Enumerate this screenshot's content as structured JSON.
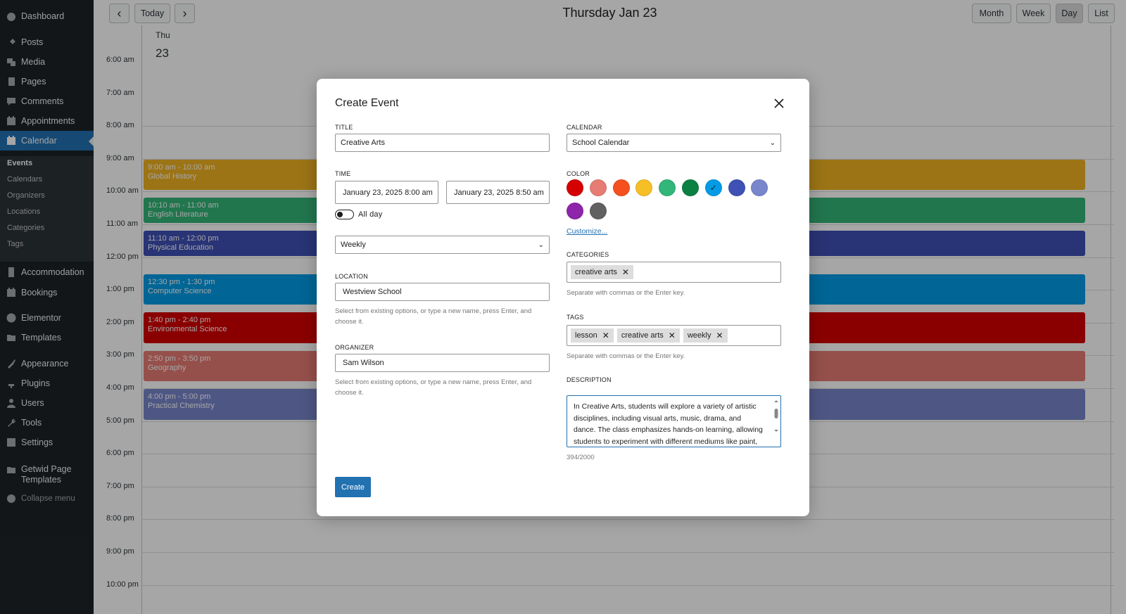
{
  "sidebar": {
    "items": [
      {
        "label": "Dashboard",
        "icon": "dashboard-icon"
      },
      {
        "label": "Posts",
        "icon": "pin-icon"
      },
      {
        "label": "Media",
        "icon": "media-icon"
      },
      {
        "label": "Pages",
        "icon": "pages-icon"
      },
      {
        "label": "Comments",
        "icon": "comment-icon"
      },
      {
        "label": "Appointments",
        "icon": "calendar-icon"
      },
      {
        "label": "Calendar",
        "icon": "calendar-icon"
      },
      {
        "label": "Accommodation",
        "icon": "building-icon"
      },
      {
        "label": "Bookings",
        "icon": "calendar-icon"
      },
      {
        "label": "Elementor",
        "icon": "elementor-icon"
      },
      {
        "label": "Templates",
        "icon": "folder-icon"
      },
      {
        "label": "Appearance",
        "icon": "brush-icon"
      },
      {
        "label": "Plugins",
        "icon": "plugin-icon"
      },
      {
        "label": "Users",
        "icon": "user-icon"
      },
      {
        "label": "Tools",
        "icon": "wrench-icon"
      },
      {
        "label": "Settings",
        "icon": "settings-icon"
      },
      {
        "label": "Getwid Page Templates",
        "icon": "folder-icon"
      },
      {
        "label": "Collapse menu",
        "icon": "collapse-icon"
      }
    ],
    "submenu": [
      "Events",
      "Calendars",
      "Organizers",
      "Locations",
      "Categories",
      "Tags"
    ]
  },
  "toolbar": {
    "prev_icon": "‹",
    "today_label": "Today",
    "next_icon": "›",
    "title": "Thursday Jan 23",
    "views": [
      "Month",
      "Week",
      "Day",
      "List"
    ],
    "active_view": "Day"
  },
  "day_header": {
    "name": "Thu",
    "number": "23"
  },
  "time_labels": [
    "6:00 am",
    "7:00 am",
    "8:00 am",
    "9:00 am",
    "10:00 am",
    "11:00 am",
    "12:00 pm",
    "1:00 pm",
    "2:00 pm",
    "3:00 pm",
    "4:00 pm",
    "5:00 pm",
    "6:00 pm",
    "7:00 pm",
    "8:00 pm",
    "9:00 pm",
    "10:00 pm"
  ],
  "events": [
    {
      "time": "9:00 am - 10:00 am",
      "title": "Global History",
      "color": "#f0b323",
      "start": 9.0,
      "end": 10.0
    },
    {
      "time": "10:10 am - 11:00 am",
      "title": "English Literature",
      "color": "#33b679",
      "start": 10.1667,
      "end": 11.0
    },
    {
      "time": "11:10 am - 12:00 pm",
      "title": "Physical Education",
      "color": "#3f51b5",
      "start": 11.1667,
      "end": 12.0
    },
    {
      "time": "12:30 pm - 1:30 pm",
      "title": "Computer Science",
      "color": "#039be5",
      "start": 12.5,
      "end": 13.5
    },
    {
      "time": "1:40 pm - 2:40 pm",
      "title": "Environmental Science",
      "color": "#d50000",
      "start": 13.6667,
      "end": 14.6667
    },
    {
      "time": "2:50 pm - 3:50 pm",
      "title": "Geography",
      "color": "#e67c73",
      "start": 14.8333,
      "end": 15.8333
    },
    {
      "time": "4:00 pm - 5:00 pm",
      "title": "Practical Chemistry",
      "color": "#7986cb",
      "start": 16.0,
      "end": 17.0
    }
  ],
  "modal": {
    "title": "Create Event",
    "close_icon": "✕",
    "title_label": "Title",
    "title_value": "Creative Arts",
    "time_label": "Time",
    "start_value": "January 23, 2025 8:00 am",
    "end_value": "January 23, 2025 8:50 am",
    "all_day_label": "All day",
    "all_day": false,
    "repeat_value": "Weekly",
    "location_label": "Location",
    "location_value": "Westview School",
    "location_help": "Select from existing options, or type a new name, press Enter, and choose it.",
    "organizer_label": "Organizer",
    "organizer_value": "Sam Wilson",
    "organizer_help": "Select from existing options, or type a new name, press Enter, and choose it.",
    "calendar_label": "Calendar",
    "calendar_value": "School Calendar",
    "color_label": "Color",
    "colors": [
      "#d50000",
      "#e67c73",
      "#f4511e",
      "#f6bf26",
      "#33b679",
      "#0b8043",
      "#039be5",
      "#3f51b5",
      "#7986cb",
      "#8e24aa",
      "#616161"
    ],
    "selected_color": "#039be5",
    "customize_label": "Customize...",
    "categories_label": "Categories",
    "categories": [
      "creative arts"
    ],
    "categories_help": "Separate with commas or the Enter key.",
    "tags_label": "Tags",
    "tags": [
      "lesson",
      "creative arts",
      "weekly"
    ],
    "tags_help": "Separate with commas or the Enter key.",
    "description_label": "Description",
    "description": "In Creative Arts, students will explore a variety of artistic disciplines, including visual arts, music, drama, and dance. The class emphasizes hands-on learning, allowing students to experiment with different mediums like paint,",
    "counter": "394/2000",
    "create_label": "Create"
  }
}
